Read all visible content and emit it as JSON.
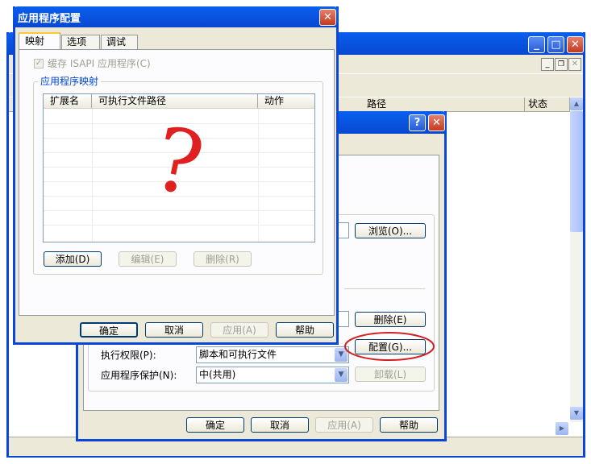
{
  "colors": {
    "xp_blue": "#0054e3",
    "xp_face": "#ece9d8",
    "red_mark": "#e02020",
    "red_circle": "#d32020"
  },
  "back_window": {
    "headers": [
      "路径",
      "状态"
    ]
  },
  "mid_dialog": {
    "browse_btn": "浏览(O)...",
    "remove_btn": "删除(E)",
    "configure_btn": "配置(G)...",
    "unload_btn": "卸载(L)",
    "exec_perm_label": "执行权限(P):",
    "exec_perm_value": "脚本和可执行文件",
    "app_protect_label": "应用程序保护(N):",
    "app_protect_value": "中(共用)",
    "ok": "确定",
    "cancel": "取消",
    "apply": "应用(A)",
    "help": "帮助"
  },
  "dialog": {
    "title": "应用程序配置",
    "tabs": [
      "映射",
      "选项",
      "调试"
    ],
    "cache_checkbox_label": "缓存 ISAPI 应用程序(C)",
    "group_label": "应用程序映射",
    "columns": [
      "扩展名",
      "可执行文件路径",
      "动作"
    ],
    "question_mark": "?",
    "add_btn": "添加(D)",
    "edit_btn": "编辑(E)",
    "delete_btn": "删除(R)",
    "ok": "确定",
    "cancel": "取消",
    "apply": "应用(A)",
    "help": "帮助"
  },
  "icons": [
    "close-icon",
    "help-icon",
    "minimize-icon",
    "maximize-icon",
    "restore-icon",
    "scroll-up-icon",
    "scroll-down-icon",
    "scroll-right-icon",
    "dropdown-arrow-icon",
    "checkbox-checked-icon"
  ]
}
